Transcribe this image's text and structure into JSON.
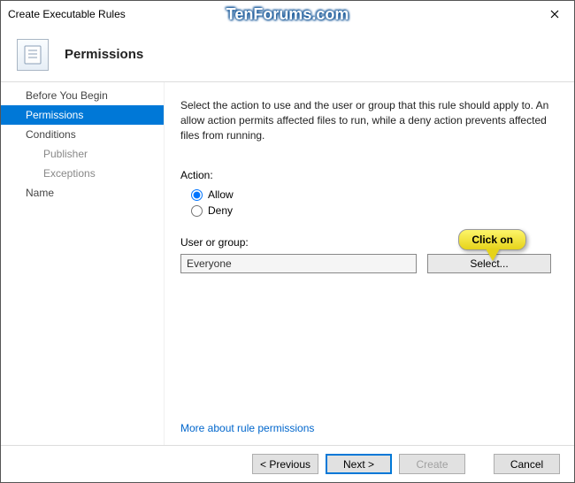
{
  "window": {
    "title": "Create Executable Rules",
    "brand": "TenForums.com"
  },
  "header": {
    "title": "Permissions"
  },
  "sidebar": {
    "items": [
      {
        "label": "Before You Begin",
        "level": 1,
        "active": false
      },
      {
        "label": "Permissions",
        "level": 1,
        "active": true
      },
      {
        "label": "Conditions",
        "level": 1,
        "active": false
      },
      {
        "label": "Publisher",
        "level": 2,
        "active": false
      },
      {
        "label": "Exceptions",
        "level": 2,
        "active": false
      },
      {
        "label": "Name",
        "level": 1,
        "active": false
      }
    ]
  },
  "content": {
    "instruction": "Select the action to use and the user or group that this rule should apply to. An allow action permits affected files to run, while a deny action prevents affected files from running.",
    "action_label": "Action:",
    "radio_allow": "Allow",
    "radio_deny": "Deny",
    "user_group_label": "User or group:",
    "user_group_value": "Everyone",
    "select_button": "Select...",
    "more_link": "More about rule permissions"
  },
  "callout": {
    "text": "Click on"
  },
  "footer": {
    "previous": "< Previous",
    "next": "Next >",
    "create": "Create",
    "cancel": "Cancel"
  }
}
